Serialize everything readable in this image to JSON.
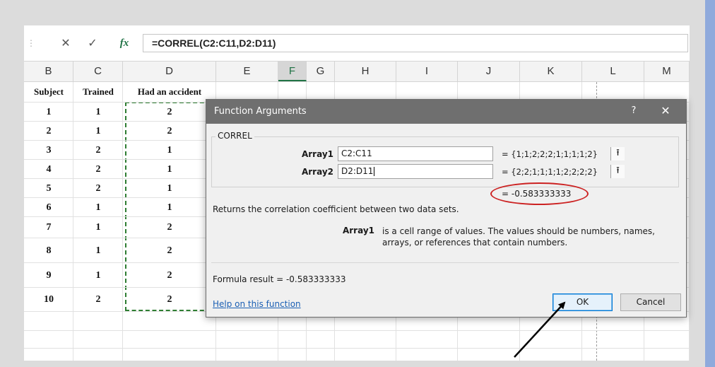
{
  "formula_bar": {
    "cancel_icon": "x-icon",
    "cancel_glyph": "✕",
    "enter_icon": "check-icon",
    "enter_glyph": "✓",
    "fx_label": "fx",
    "formula": "=CORREL(C2:C11,D2:D11)"
  },
  "columns": [
    "B",
    "C",
    "D",
    "E",
    "F",
    "G",
    "H",
    "I",
    "J",
    "K",
    "L",
    "M"
  ],
  "active_column": "F",
  "table": {
    "headers": [
      "Subject",
      "Trained",
      "Had an accident"
    ],
    "rows": [
      [
        "1",
        "1",
        "2"
      ],
      [
        "2",
        "1",
        "2"
      ],
      [
        "3",
        "2",
        "1"
      ],
      [
        "4",
        "2",
        "1"
      ],
      [
        "5",
        "2",
        "1"
      ],
      [
        "6",
        "1",
        "1"
      ],
      [
        "7",
        "1",
        "2"
      ],
      [
        "8",
        "1",
        "2"
      ],
      [
        "9",
        "1",
        "2"
      ],
      [
        "10",
        "2",
        "2"
      ]
    ]
  },
  "dialog": {
    "title": "Function Arguments",
    "help_glyph": "?",
    "close_glyph": "✕",
    "function_name": "CORREL",
    "args": [
      {
        "label": "Array1",
        "value": "C2:C11",
        "evaluated": "=  {1;1;2;2;2;1;1;1;1;2}"
      },
      {
        "label": "Array2",
        "value": "D2:D11",
        "evaluated": "=  {2;2;1;1;1;1;2;2;2;2}"
      }
    ],
    "collapse_glyph": "⭱",
    "result_eq": "=  -0.583333333",
    "description": "Returns the correlation coefficient between two data sets.",
    "arg_help_name": "Array1",
    "arg_help_text": "is a cell range of values. The values should be numbers, names, arrays, or references that contain numbers.",
    "formula_result": "Formula result =   -0.583333333",
    "help_link": "Help on this function",
    "ok_label": "OK",
    "cancel_label": "Cancel"
  },
  "colors": {
    "title_bar": "#6f6f6f",
    "marquee": "#2e7d32",
    "annotation_circle": "#cc2222",
    "link": "#1a5fb4"
  }
}
